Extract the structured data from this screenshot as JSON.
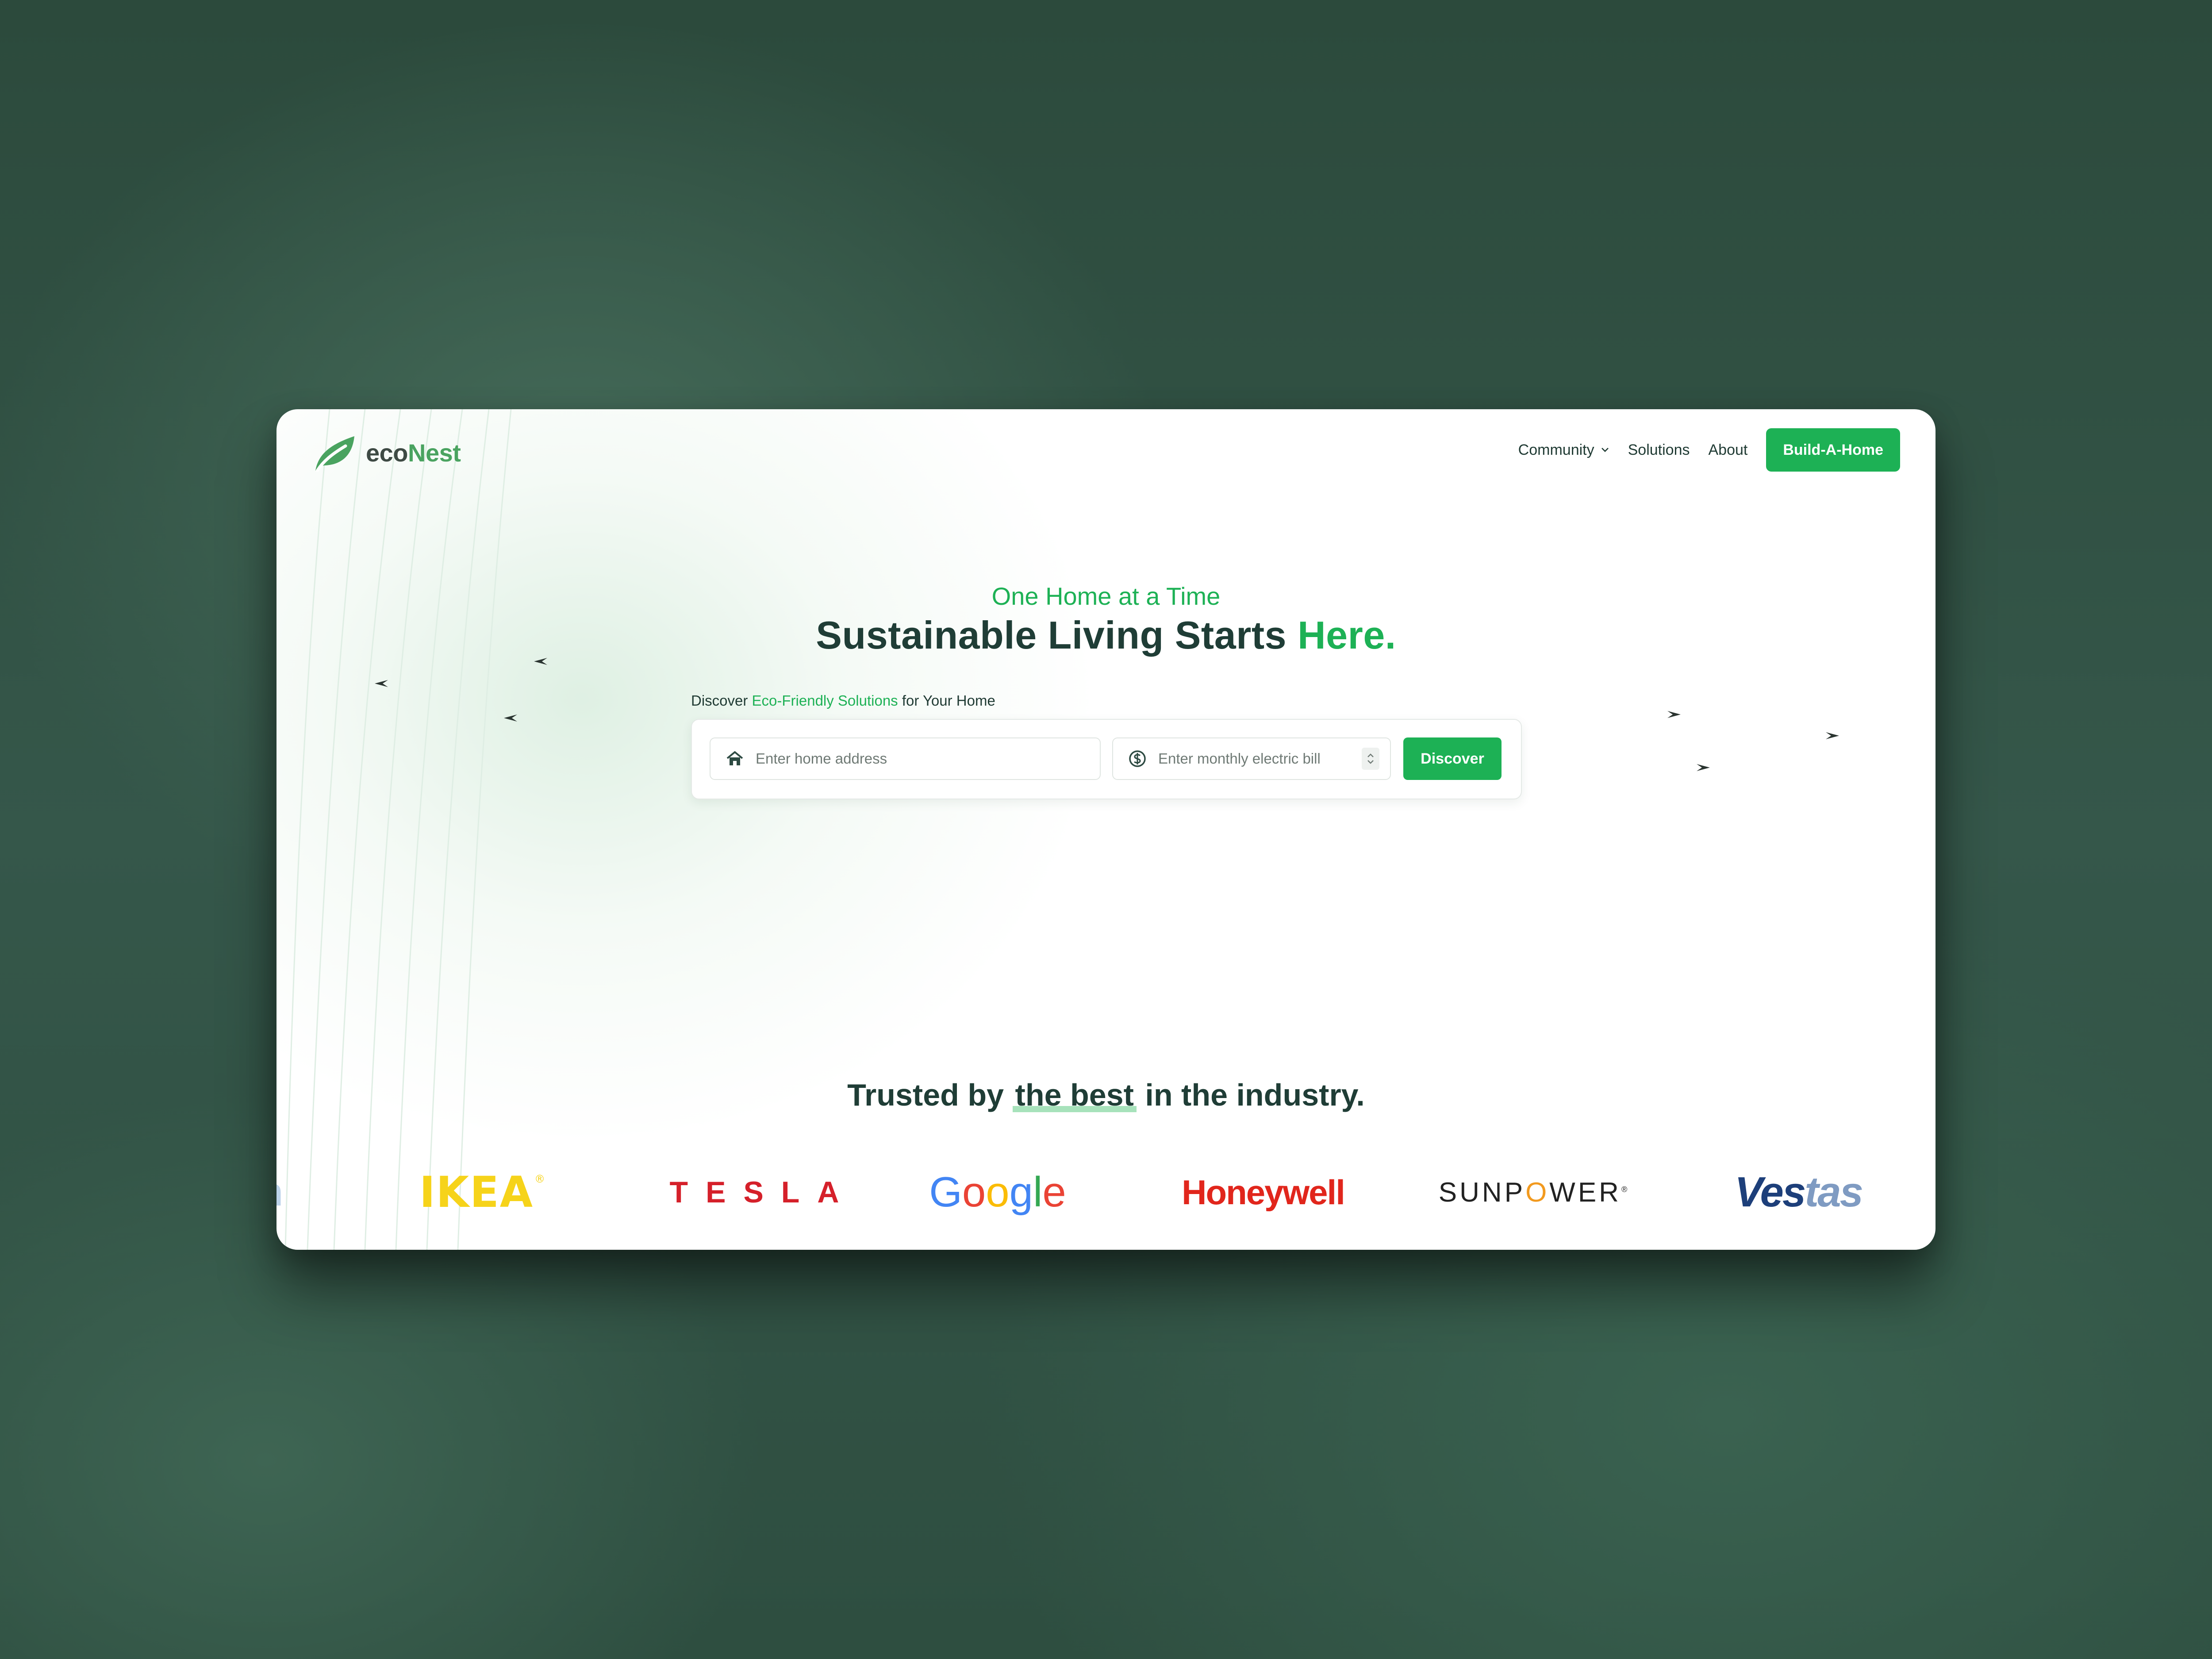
{
  "brand": {
    "eco": "eco",
    "nest": "Nest"
  },
  "nav": {
    "community": "Community",
    "solutions": "Solutions",
    "about": "About",
    "cta": "Build-A-Home"
  },
  "hero": {
    "subtitle": "One Home at a Time",
    "title_main": "Sustainable Living Starts ",
    "title_accent": "Here."
  },
  "discover": {
    "label_prefix": "Discover ",
    "label_accent": "Eco-Friendly Solutions",
    "label_suffix": " for Your Home",
    "address_placeholder": "Enter home address",
    "bill_placeholder": "Enter monthly electric bill",
    "button": "Discover"
  },
  "trusted": {
    "prefix": "Trusted by ",
    "highlight": "the best",
    "suffix": " in the industry."
  },
  "logos": {
    "partial": "n",
    "ikea": "IKEA",
    "ikea_mark": "®",
    "tesla": "TESLA",
    "google": [
      "G",
      "o",
      "o",
      "g",
      "l",
      "e"
    ],
    "honeywell": "Honeywell",
    "sunpower_a": "SUNP",
    "sunpower_o": "O",
    "sunpower_b": "WER",
    "sunpower_mark": "®",
    "vestas_a": "Ves",
    "vestas_b": "tas"
  },
  "colors": {
    "primary_green": "#1db155",
    "dark_text": "#1f3d36",
    "logo_green": "#4aa360"
  },
  "icons": {
    "logo": "leaf-icon",
    "community_caret": "chevron-down-icon",
    "address": "home-icon",
    "bill": "dollar-circle-icon",
    "stepper": "stepper-arrows-icon",
    "birds": "bird-icon"
  }
}
